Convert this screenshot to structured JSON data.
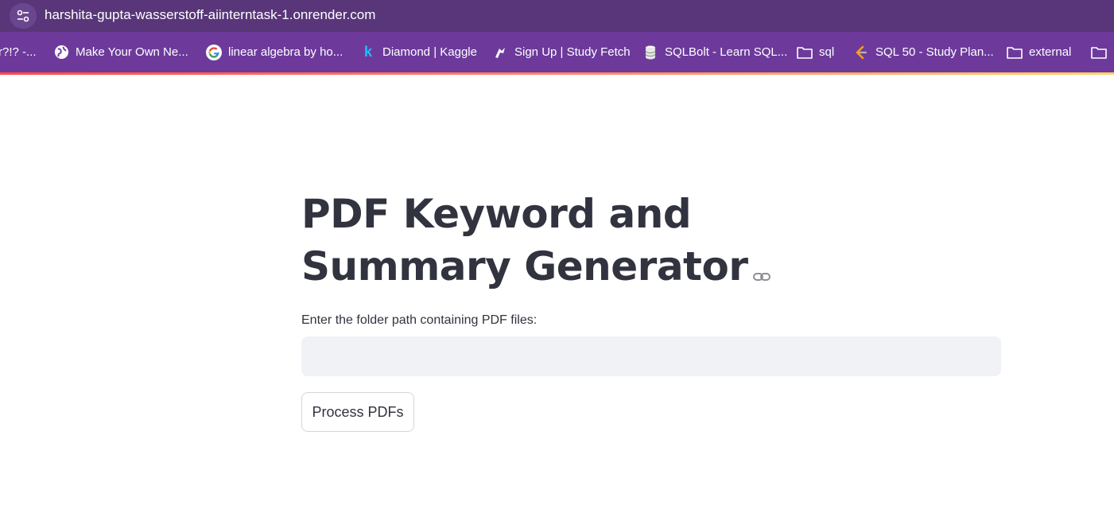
{
  "browser": {
    "url": "harshita-gupta-wasserstoff-aiinterntask-1.onrender.com",
    "bookmarks": [
      {
        "label": "r?!? -...",
        "icon": "none"
      },
      {
        "label": "Make Your Own Ne...",
        "icon": "globe-icon"
      },
      {
        "label": "linear algebra by ho...",
        "icon": "google-icon"
      },
      {
        "label": "Diamond | Kaggle",
        "icon": "kaggle-icon"
      },
      {
        "label": "Sign Up | Study Fetch",
        "icon": "studyfetch-icon"
      },
      {
        "label": "SQLBolt - Learn SQL...",
        "icon": "database-icon"
      },
      {
        "label": "sql",
        "icon": "folder-icon"
      },
      {
        "label": "SQL 50 - Study Plan...",
        "icon": "leetcode-icon"
      },
      {
        "label": "external",
        "icon": "folder-icon"
      }
    ]
  },
  "app": {
    "title": "PDF Keyword and Summary Generator",
    "input_label": "Enter the folder path containing PDF files:",
    "input_value": "",
    "button_label": "Process PDFs"
  },
  "colors": {
    "address_bar": "#583679",
    "bookmarks_bar": "#6d3a9c",
    "text": "#31333f",
    "input_bg": "#f0f2f6"
  }
}
